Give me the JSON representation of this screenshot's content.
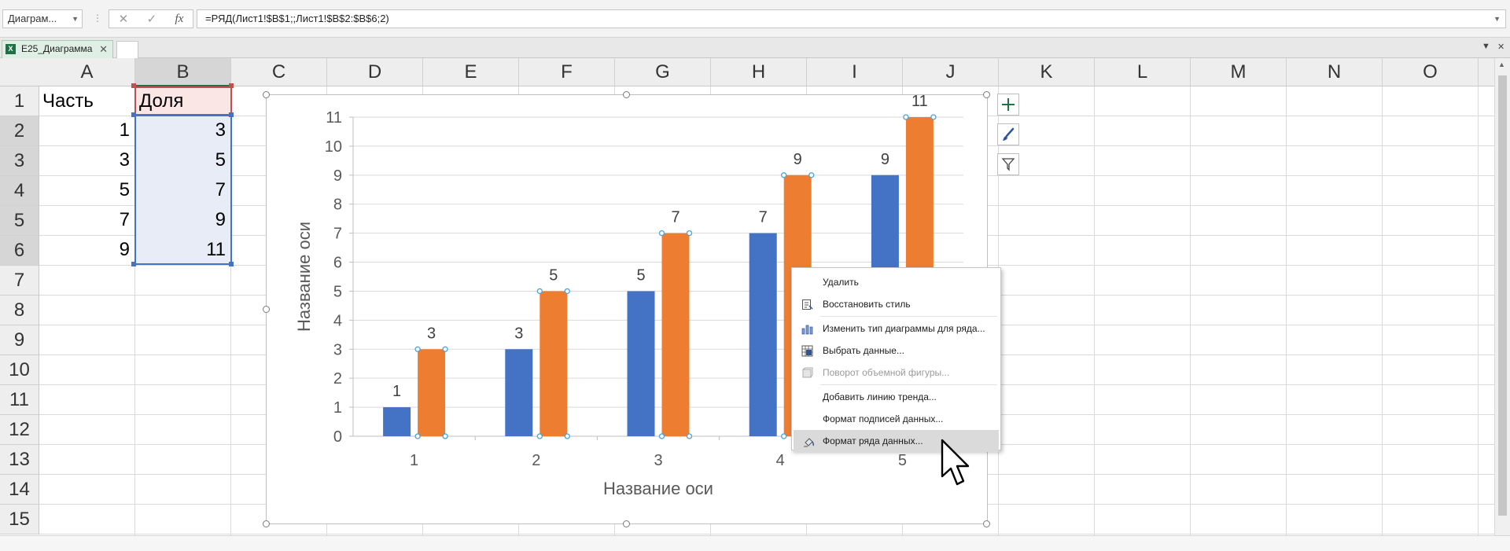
{
  "formula_bar": {
    "name_box": "Диаграм...",
    "cancel_icon": "✕",
    "enter_icon": "✓",
    "fx_label": "fx",
    "formula": "=РЯД(Лист1!$B$1;;Лист1!$B$2:$B$6;2)"
  },
  "tabs": {
    "workbook_tab": "E25_Диаграмма"
  },
  "grid": {
    "columns": [
      "A",
      "B",
      "C",
      "D",
      "E",
      "F",
      "G",
      "H",
      "I",
      "J",
      "K",
      "L",
      "M",
      "N",
      "O"
    ],
    "rows": [
      "1",
      "2",
      "3",
      "4",
      "5",
      "6",
      "7",
      "8",
      "9",
      "10",
      "11",
      "12",
      "13",
      "14",
      "15"
    ],
    "cells": {
      "A1": "Часть",
      "B1": "Доля",
      "A2": "1",
      "B2": "3",
      "A3": "3",
      "B3": "5",
      "A4": "5",
      "B4": "7",
      "A5": "7",
      "B5": "9",
      "A6": "9",
      "B6": "11"
    }
  },
  "chart": {
    "ylabel": "Название оси",
    "xlabel": "Название оси"
  },
  "chart_data": {
    "type": "bar",
    "categories": [
      "1",
      "2",
      "3",
      "4",
      "5"
    ],
    "series": [
      {
        "values": [
          1,
          3,
          5,
          7,
          9
        ],
        "color": "#4472c4"
      },
      {
        "values": [
          3,
          5,
          7,
          9,
          11
        ],
        "color": "#ed7d31"
      }
    ],
    "xlabel": "Название оси",
    "ylabel": "Название оси",
    "ylim": [
      0,
      11
    ],
    "yticks": [
      "0",
      "1",
      "2",
      "3",
      "4",
      "5",
      "6",
      "7",
      "8",
      "9",
      "10",
      "11"
    ],
    "grid": true,
    "data_labels": true
  },
  "context_menu": {
    "items": [
      {
        "label": "Удалить",
        "icon": "none",
        "disabled": false
      },
      {
        "label": "Восстановить стиль",
        "icon": "reset-style-icon",
        "disabled": false
      },
      {
        "label": "Изменить тип диаграммы для ряда...",
        "icon": "chart-type-icon",
        "disabled": false
      },
      {
        "label": "Выбрать данные...",
        "icon": "select-data-icon",
        "disabled": false
      },
      {
        "label": "Поворот объемной фигуры...",
        "icon": "rotation-3d-icon",
        "disabled": true
      },
      {
        "label": "Добавить линию тренда...",
        "icon": "none",
        "disabled": false
      },
      {
        "label": "Формат подписей данных...",
        "icon": "none",
        "disabled": false
      },
      {
        "label": "Формат ряда данных...",
        "icon": "format-series-icon",
        "disabled": false,
        "highlighted": true
      }
    ]
  },
  "colors": {
    "excel_green": "#217346",
    "series1": "#4472c4",
    "series2": "#ed7d31"
  }
}
